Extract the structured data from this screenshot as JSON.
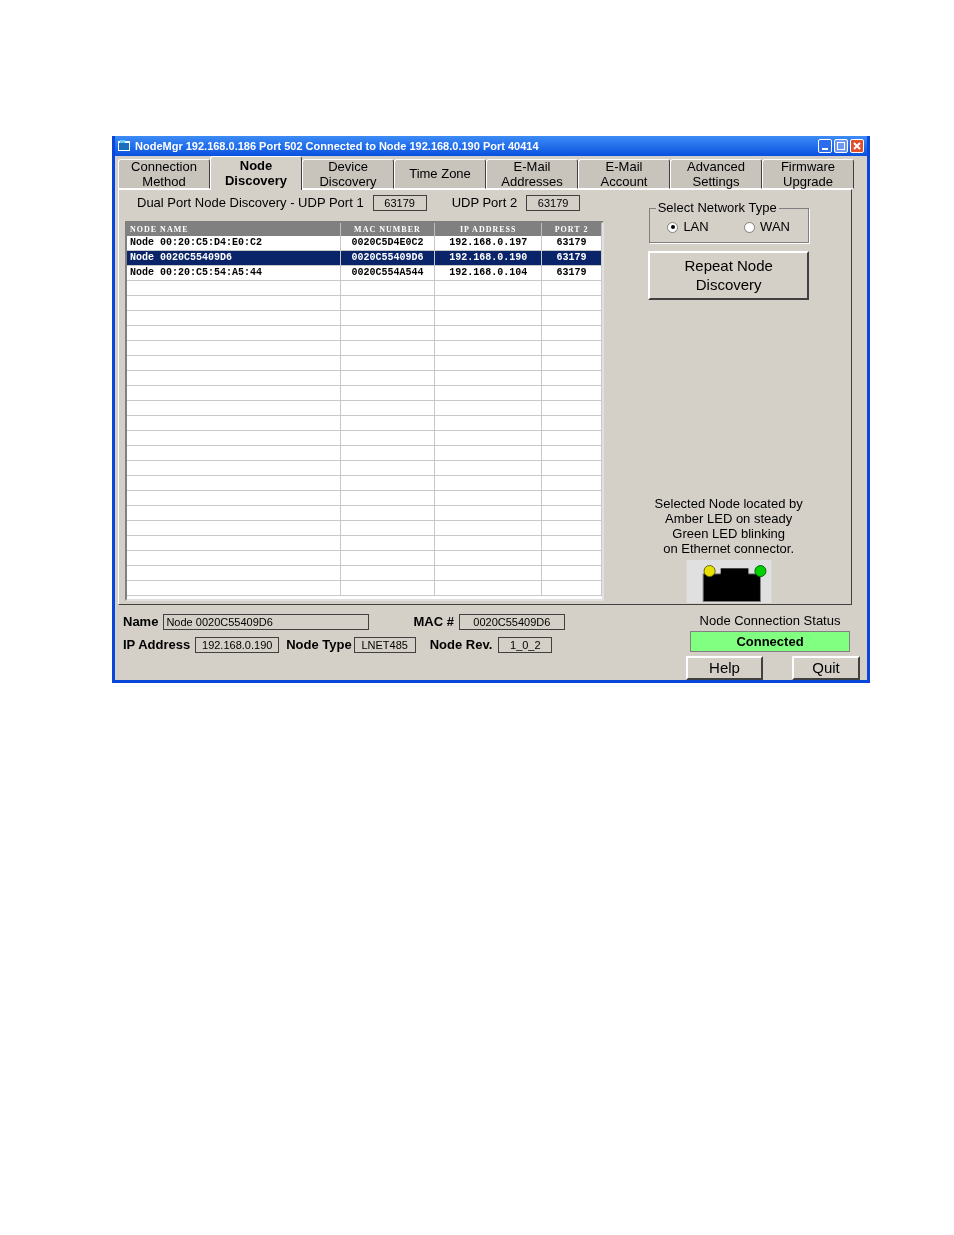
{
  "window": {
    "title": "NodeMgr 192.168.0.186  Port 502  Connected to  Node 192.168.0.190  Port 40414"
  },
  "tabs": [
    {
      "lines": [
        "Connection",
        "Method"
      ],
      "selected": false
    },
    {
      "lines": [
        "Node",
        "Discovery"
      ],
      "selected": true
    },
    {
      "lines": [
        "Device",
        "Discovery"
      ],
      "selected": false
    },
    {
      "lines": [
        "Time Zone"
      ],
      "selected": false
    },
    {
      "lines": [
        "E-Mail",
        "Addresses"
      ],
      "selected": false
    },
    {
      "lines": [
        "E-Mail",
        "Account"
      ],
      "selected": false
    },
    {
      "lines": [
        "Advanced",
        "Settings"
      ],
      "selected": false
    },
    {
      "lines": [
        "Firmware",
        "Upgrade"
      ],
      "selected": false
    }
  ],
  "discovery": {
    "label": "Dual Port Node Discovery - UDP Port 1",
    "port_1": "63179",
    "port_2_label": "UDP Port 2",
    "port_2": "63179"
  },
  "table": {
    "columns": [
      "NODE NAME",
      "MAC NUMBER",
      "IP ADDRESS",
      "PORT 2"
    ],
    "rows": [
      {
        "cells": [
          "Node 00:20:C5:D4:E0:C2",
          "0020C5D4E0C2",
          "192.168.0.197",
          "63179"
        ],
        "selected": false
      },
      {
        "cells": [
          "Node 0020C55409D6",
          "0020C55409D6",
          "192.168.0.190",
          "63179"
        ],
        "selected": true
      },
      {
        "cells": [
          "Node 00:20:C5:54:A5:44",
          "0020C554A544",
          "192.168.0.104",
          "63179"
        ],
        "selected": false
      }
    ]
  },
  "network_type": {
    "title": "Select Network Type",
    "options": [
      {
        "label": "LAN",
        "selected": true
      },
      {
        "label": "WAN",
        "selected": false
      }
    ]
  },
  "repeat_button": {
    "lines": [
      "Repeat Node",
      "Discovery"
    ]
  },
  "locator_note": [
    "Selected Node located by",
    "Amber LED on steady",
    "Green LED blinking",
    "on Ethernet connector."
  ],
  "details": {
    "name_label": "Name",
    "name": "Node 0020C55409D6",
    "mac_label": "MAC #",
    "mac": "0020C55409D6",
    "ip_label": "IP Address",
    "ip": "192.168.0.190",
    "type_label": "Node Type",
    "type": "LNET485",
    "rev_label": "Node Rev.",
    "rev": "1_0_2"
  },
  "status": {
    "label": "Node Connection Status",
    "value": "Connected",
    "ok": true
  },
  "buttons": [
    "Help",
    "Quit"
  ]
}
